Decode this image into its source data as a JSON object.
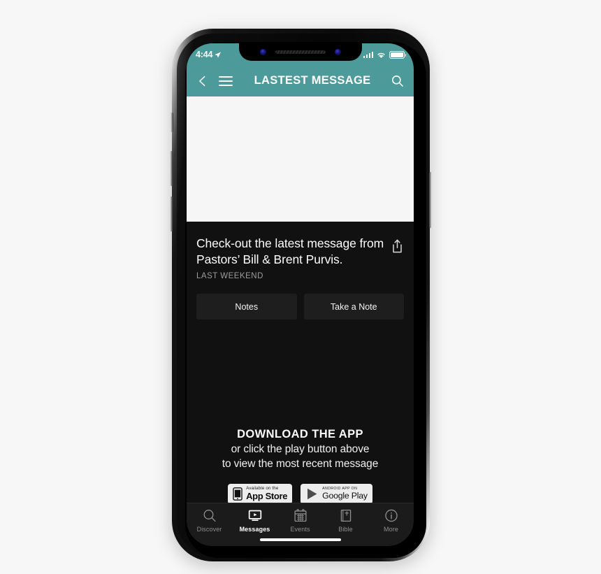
{
  "device": {
    "name": "iphone-x-mockup",
    "frame_color": "#0d0d0d",
    "screen_bg": "#111111"
  },
  "status_bar": {
    "time": "4:44",
    "location_icon": "location-arrow-icon",
    "signal_icon": "cellular-signal-icon",
    "wifi_icon": "wifi-icon",
    "battery_icon": "battery-full-icon",
    "background": "#4d9a9a"
  },
  "header": {
    "back_icon": "chevron-left-icon",
    "menu_icon": "hamburger-menu-icon",
    "title": "LASTEST MESSAGE",
    "search_icon": "search-icon",
    "background": "#4d9a9a"
  },
  "media": {
    "name": "video-player-area",
    "background": "#f6f6f6"
  },
  "content": {
    "headline": "Check-out the latest message from Pastors’ Bill & Brent Purvis.",
    "share_icon": "share-icon",
    "subtitle": "LAST WEEKEND",
    "buttons": [
      {
        "label": "Notes",
        "name": "notes-button"
      },
      {
        "label": "Take a Note",
        "name": "take-a-note-button"
      }
    ]
  },
  "download": {
    "title": "DOWNLOAD THE APP",
    "line2": "or click the play button above",
    "line3": "to view the most recent message",
    "badges": [
      {
        "name": "app-store-badge",
        "icon": "apple-iphone-icon",
        "small_text": "Available on the",
        "big_text": "App Store"
      },
      {
        "name": "google-play-badge",
        "icon": "google-play-triangle-icon",
        "small_text": "ANDROID APP ON",
        "big_text": "Google Play"
      }
    ]
  },
  "tabbar": {
    "items": [
      {
        "label": "Discover",
        "icon": "search-icon",
        "name": "tab-discover",
        "active": false
      },
      {
        "label": "Messages",
        "icon": "monitor-play-icon",
        "name": "tab-messages",
        "active": true
      },
      {
        "label": "Events",
        "icon": "calendar-icon",
        "name": "tab-events",
        "active": false
      },
      {
        "label": "Bible",
        "icon": "bible-book-icon",
        "name": "tab-bible",
        "active": false
      },
      {
        "label": "More",
        "icon": "info-circle-icon",
        "name": "tab-more",
        "active": false
      }
    ]
  }
}
